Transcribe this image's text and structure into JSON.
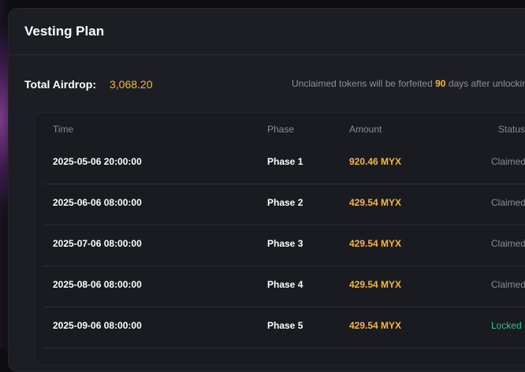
{
  "modal": {
    "title": "Vesting Plan"
  },
  "summary": {
    "total_label": "Total Airdrop:",
    "total_value": "3,068.20",
    "notice_prefix": "Unclaimed tokens will be forfeited",
    "notice_days": "90",
    "notice_suffix": "days after unlocking"
  },
  "table": {
    "headers": {
      "time": "Time",
      "phase": "Phase",
      "amount": "Amount",
      "status": "Status"
    },
    "rows": [
      {
        "time": "2025-05-06 20:00:00",
        "phase": "Phase 1",
        "amount": "920.46 MYX",
        "status": "Claimed"
      },
      {
        "time": "2025-06-06 08:00:00",
        "phase": "Phase 2",
        "amount": "429.54 MYX",
        "status": "Claimed"
      },
      {
        "time": "2025-07-06 08:00:00",
        "phase": "Phase 3",
        "amount": "429.54 MYX",
        "status": "Claimed"
      },
      {
        "time": "2025-08-06 08:00:00",
        "phase": "Phase 4",
        "amount": "429.54 MYX",
        "status": "Claimed"
      },
      {
        "time": "2025-09-06 08:00:00",
        "phase": "Phase 5",
        "amount": "429.54 MYX",
        "status": "Locked"
      }
    ]
  },
  "colors": {
    "accent": "#f5b73b",
    "locked": "#2bc48a",
    "muted": "#8a8b93"
  }
}
